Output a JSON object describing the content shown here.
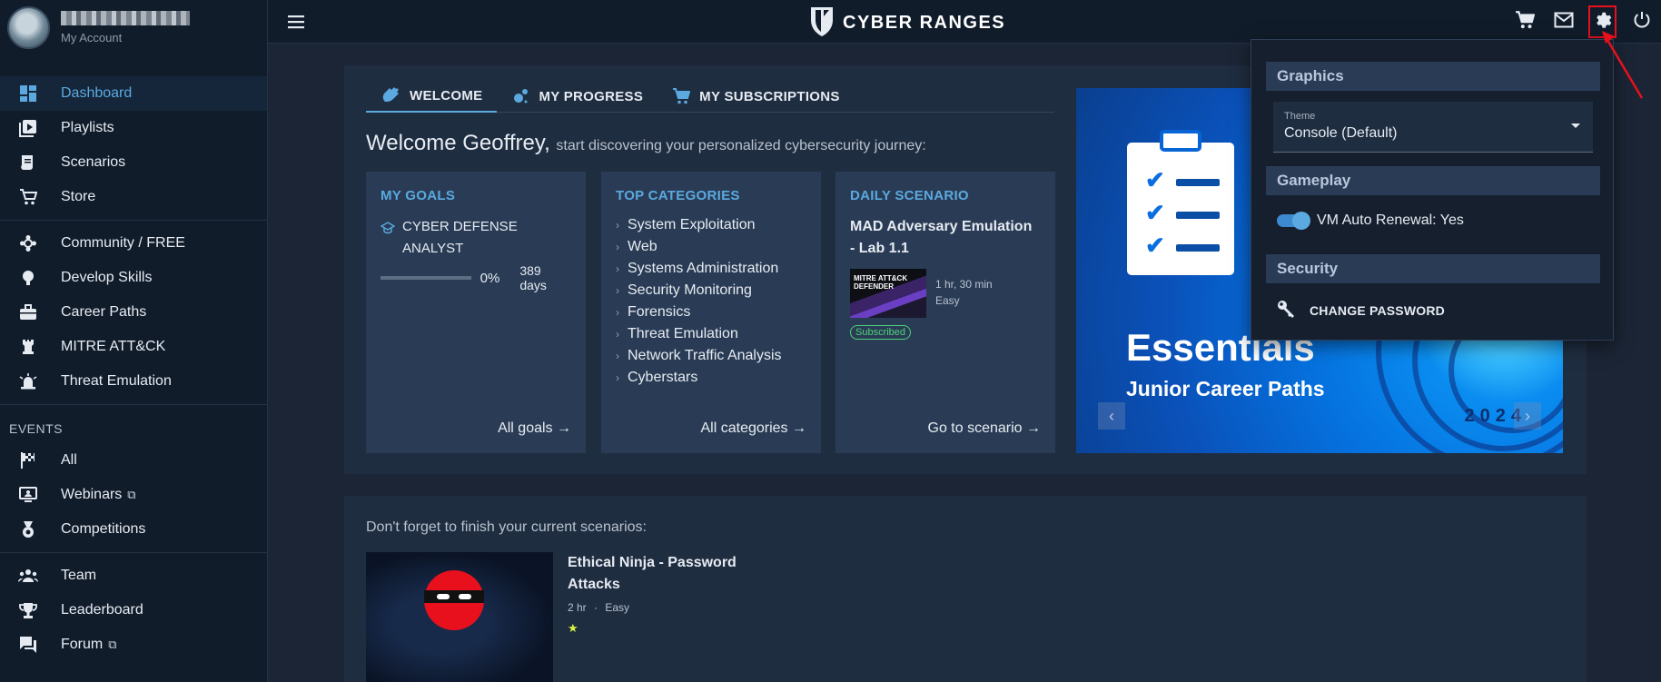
{
  "profile": {
    "subtitle": "My Account"
  },
  "brand": {
    "name": "CYBER RANGES"
  },
  "sidebar": {
    "group1": [
      {
        "label": "Dashboard",
        "icon": "dashboard-icon"
      },
      {
        "label": "Playlists",
        "icon": "playlist-icon"
      },
      {
        "label": "Scenarios",
        "icon": "scroll-icon"
      },
      {
        "label": "Store",
        "icon": "cart-icon"
      }
    ],
    "group2": [
      {
        "label": "Community / FREE",
        "icon": "community-icon"
      },
      {
        "label": "Develop Skills",
        "icon": "lightbulb-icon"
      },
      {
        "label": "Career Paths",
        "icon": "briefcase-icon"
      },
      {
        "label": "MITRE ATT&CK",
        "icon": "rook-icon"
      },
      {
        "label": "Threat Emulation",
        "icon": "alarm-icon"
      }
    ],
    "events_label": "EVENTS",
    "events": [
      {
        "label": "All",
        "icon": "flag-icon"
      },
      {
        "label": "Webinars",
        "icon": "presentation-icon"
      },
      {
        "label": "Competitions",
        "icon": "medal-icon"
      }
    ],
    "group4": [
      {
        "label": "Team",
        "icon": "team-icon"
      },
      {
        "label": "Leaderboard",
        "icon": "trophy-icon"
      },
      {
        "label": "Forum",
        "icon": "forum-icon"
      }
    ]
  },
  "tabs": [
    {
      "label": "WELCOME"
    },
    {
      "label": "MY PROGRESS"
    },
    {
      "label": "MY SUBSCRIPTIONS"
    }
  ],
  "welcome": {
    "greeting": "Welcome Geoffrey,",
    "subtitle": "start discovering your personalized cybersecurity journey:"
  },
  "goals": {
    "title": "MY GOALS",
    "goal_name": "CYBER DEFENSE ANALYST",
    "progress": "0%",
    "progress_value": 0,
    "days": "389 days",
    "footer": "All goals →"
  },
  "categories": {
    "title": "TOP CATEGORIES",
    "items": [
      "System Exploitation",
      "Web",
      "Systems Administration",
      "Security Monitoring",
      "Forensics",
      "Threat Emulation",
      "Network Traffic Analysis",
      "Cyberstars"
    ],
    "footer": "All categories →"
  },
  "daily": {
    "title": "DAILY SCENARIO",
    "scenario_name": "MAD Adversary Emulation - Lab 1.1",
    "thumb_text": "MITRE ATT&CK DEFENDER",
    "duration": "1 hr, 30 min",
    "difficulty": "Easy",
    "badge": "Subscribed",
    "footer": "Go to scenario →"
  },
  "banner": {
    "title": "Essentials",
    "subtitle": "Junior Career Paths",
    "year": "2024"
  },
  "current": {
    "heading": "Don't forget to finish your current scenarios:",
    "title": "Ethical Ninja - Password Attacks",
    "duration": "2 hr",
    "difficulty": "Easy"
  },
  "settings": {
    "graphics_title": "Graphics",
    "theme_label": "Theme",
    "theme_value": "Console (Default)",
    "gameplay_title": "Gameplay",
    "vm_label": "VM Auto Renewal: Yes",
    "vm_enabled": true,
    "security_title": "Security",
    "password_label": "CHANGE PASSWORD"
  },
  "colors": {
    "accent": "#5ba9e0",
    "sidebar_bg": "#111c2b",
    "card_bg": "#1f2d40",
    "annotation_red": "#e8101d"
  }
}
